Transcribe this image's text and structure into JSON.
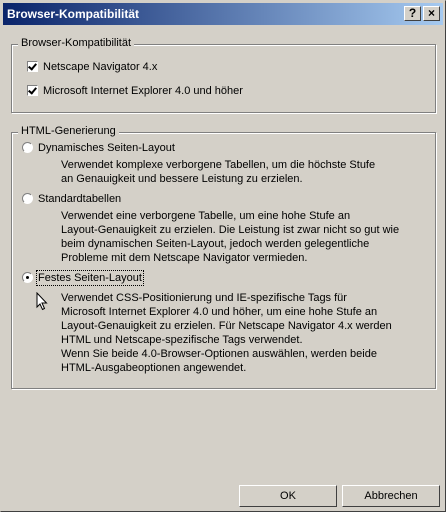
{
  "window": {
    "title": "Browser-Kompatibilität",
    "help_glyph": "?",
    "close_glyph": "×"
  },
  "browser_group": {
    "legend": "Browser-Kompatibilität",
    "options": [
      {
        "label": "Netscape Navigator 4.x",
        "checked": true
      },
      {
        "label": "Microsoft Internet Explorer 4.0 und höher",
        "checked": true
      }
    ]
  },
  "html_group": {
    "legend": "HTML-Generierung",
    "options": [
      {
        "label": "Dynamisches Seiten-Layout",
        "selected": false,
        "desc": [
          "Verwendet komplexe verborgene Tabellen, um die höchste Stufe",
          "an Genauigkeit und bessere Leistung zu erzielen."
        ]
      },
      {
        "label": "Standardtabellen",
        "selected": false,
        "desc": [
          "Verwendet eine verborgene Tabelle, um eine hohe Stufe an",
          "Layout-Genauigkeit zu erzielen. Die Leistung ist zwar nicht so gut wie",
          "beim dynamischen Seiten-Layout, jedoch werden gelegentliche",
          "Probleme mit dem Netscape Navigator vermieden."
        ]
      },
      {
        "label": "Festes Seiten-Layout",
        "selected": true,
        "desc": [
          "Verwendet CSS-Positionierung und IE-spezifische Tags für",
          "Microsoft Internet Explorer 4.0 und höher, um eine hohe Stufe an",
          "Layout-Genauigkeit zu erzielen. Für Netscape Navigator 4.x werden",
          "HTML und Netscape-spezifische Tags verwendet.",
          "Wenn Sie beide 4.0-Browser-Optionen auswählen, werden beide",
          "HTML-Ausgabeoptionen angewendet."
        ]
      }
    ]
  },
  "buttons": {
    "ok": "OK",
    "cancel": "Abbrechen"
  }
}
